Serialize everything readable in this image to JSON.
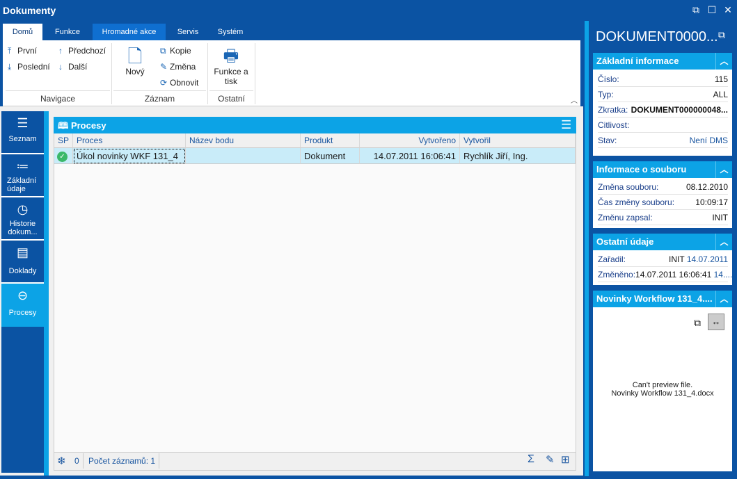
{
  "window": {
    "title": "Dokumenty",
    "controls": [
      "restore-icon",
      "maximize-icon",
      "close-icon"
    ]
  },
  "ribbon": {
    "tabs": [
      {
        "label": "Domů",
        "active": true
      },
      {
        "label": "Funkce"
      },
      {
        "label": "Hromadné akce",
        "highlighted": true
      },
      {
        "label": "Servis"
      },
      {
        "label": "Systém"
      }
    ],
    "navigace": {
      "label": "Navigace",
      "first": "První",
      "prev": "Předchozí",
      "last": "Poslední",
      "next": "Další"
    },
    "zaznam": {
      "label": "Záznam",
      "new": "Nový",
      "copy": "Kopie",
      "edit": "Změna",
      "refresh": "Obnovit"
    },
    "ostatni": {
      "label": "Ostatní",
      "print": "Funkce a tisk"
    }
  },
  "nav": [
    {
      "label": "Seznam",
      "icon": "menu-icon"
    },
    {
      "label": "Základní údaje",
      "icon": "list-icon"
    },
    {
      "label": "Historie dokum...",
      "icon": "clock-icon"
    },
    {
      "label": "Doklady",
      "icon": "document-icon"
    },
    {
      "label": "Procesy",
      "icon": "arrow-circle-icon",
      "active": true
    }
  ],
  "grid": {
    "title": "Procesy",
    "columns": [
      "SP",
      "Proces",
      "Název bodu",
      "Produkt",
      "Vytvořeno",
      "Vytvořil"
    ],
    "rows": [
      {
        "sp": "check-icon",
        "proces": "Úkol novinky WKF 131_4",
        "nazev_bodu": "",
        "produkt": "Dokument",
        "vytvoreno": "14.07.2011 16:06:41",
        "vytvoril": "Rychlík Jiří, Ing."
      }
    ],
    "footer": {
      "filter_count": "0",
      "record_count": "Počet záznamů: 1"
    }
  },
  "detail": {
    "title": "DOKUMENT0000...",
    "basic": {
      "title": "Základní informace",
      "cislo_label": "Číslo:",
      "cislo": "115",
      "typ_label": "Typ:",
      "typ": "ALL",
      "zkratka_label": "Zkratka:",
      "zkratka": "DOKUMENT000000048...",
      "citlivost_label": "Citlivost:",
      "stav_label": "Stav:",
      "stav": "Není DMS"
    },
    "file": {
      "title": "Informace o souboru",
      "zmena_label": "Změna souboru:",
      "zmena": "08.12.2010",
      "cas_label": "Čas změny souboru:",
      "cas": "10:09:17",
      "zapsal_label": "Změnu zapsal:",
      "zapsal": "INIT"
    },
    "other": {
      "title": "Ostatní údaje",
      "zaradil_label": "Zařadil:",
      "zaradil_user": "INIT",
      "zaradil_date": "14.07.2011",
      "zmeneno_label": "Změněno:",
      "zmeneno": "14.07.2011 16:06:41",
      "zmeneno_more": "14...."
    },
    "preview": {
      "title": "Novinky Workflow 131_4....",
      "message": "Can't preview file.",
      "filename": "Novinky Workflow 131_4.docx"
    }
  },
  "colors": {
    "dark_blue": "#0b53a3",
    "light_blue": "#0ca3e6",
    "selected_row": "#c9ecf9"
  }
}
